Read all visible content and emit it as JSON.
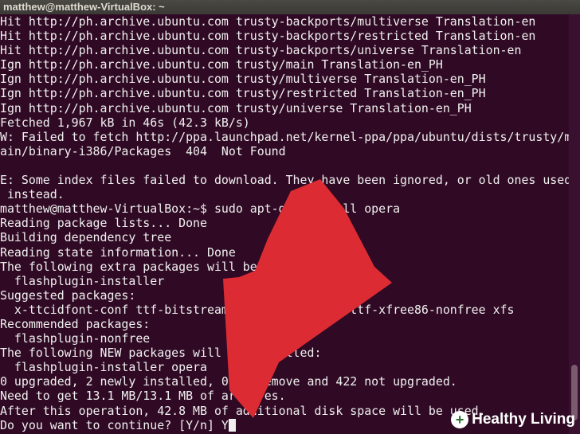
{
  "window": {
    "title": "matthew@matthew-VirtualBox: ~"
  },
  "terminal": {
    "lines": [
      "Hit http://ph.archive.ubuntu.com trusty-backports/multiverse Translation-en",
      "Hit http://ph.archive.ubuntu.com trusty-backports/restricted Translation-en",
      "Hit http://ph.archive.ubuntu.com trusty-backports/universe Translation-en",
      "Ign http://ph.archive.ubuntu.com trusty/main Translation-en_PH",
      "Ign http://ph.archive.ubuntu.com trusty/multiverse Translation-en_PH",
      "Ign http://ph.archive.ubuntu.com trusty/restricted Translation-en_PH",
      "Ign http://ph.archive.ubuntu.com trusty/universe Translation-en_PH",
      "Fetched 1,967 kB in 46s (42.3 kB/s)",
      "W: Failed to fetch http://ppa.launchpad.net/kernel-ppa/ppa/ubuntu/dists/trusty/m",
      "ain/binary-i386/Packages  404  Not Found",
      "",
      "E: Some index files failed to download. They have been ignored, or old ones used",
      " instead.",
      "matthew@matthew-VirtualBox:~$ sudo apt-get install opera",
      "Reading package lists... Done",
      "Building dependency tree",
      "Reading state information... Done",
      "The following extra packages will be installed:",
      "  flashplugin-installer",
      "Suggested packages:",
      "  x-ttcidfont-conf ttf-bitstream-vera ttf-dejavu ttf-xfree86-nonfree xfs",
      "Recommended packages:",
      "  flashplugin-nonfree",
      "The following NEW packages will be installed:",
      "  flashplugin-installer opera",
      "0 upgraded, 2 newly installed, 0 to remove and 422 not upgraded.",
      "Need to get 13.1 MB/13.1 MB of archives.",
      "After this operation, 42.8 MB of additional disk space will be used.",
      "Do you want to continue? [Y/n] Y"
    ]
  },
  "watermark": {
    "text": "Healthy Living",
    "icon": "plus-icon"
  },
  "colors": {
    "background": "#300a24",
    "text": "#f1f1f1",
    "arrow": "#dd2b33"
  }
}
